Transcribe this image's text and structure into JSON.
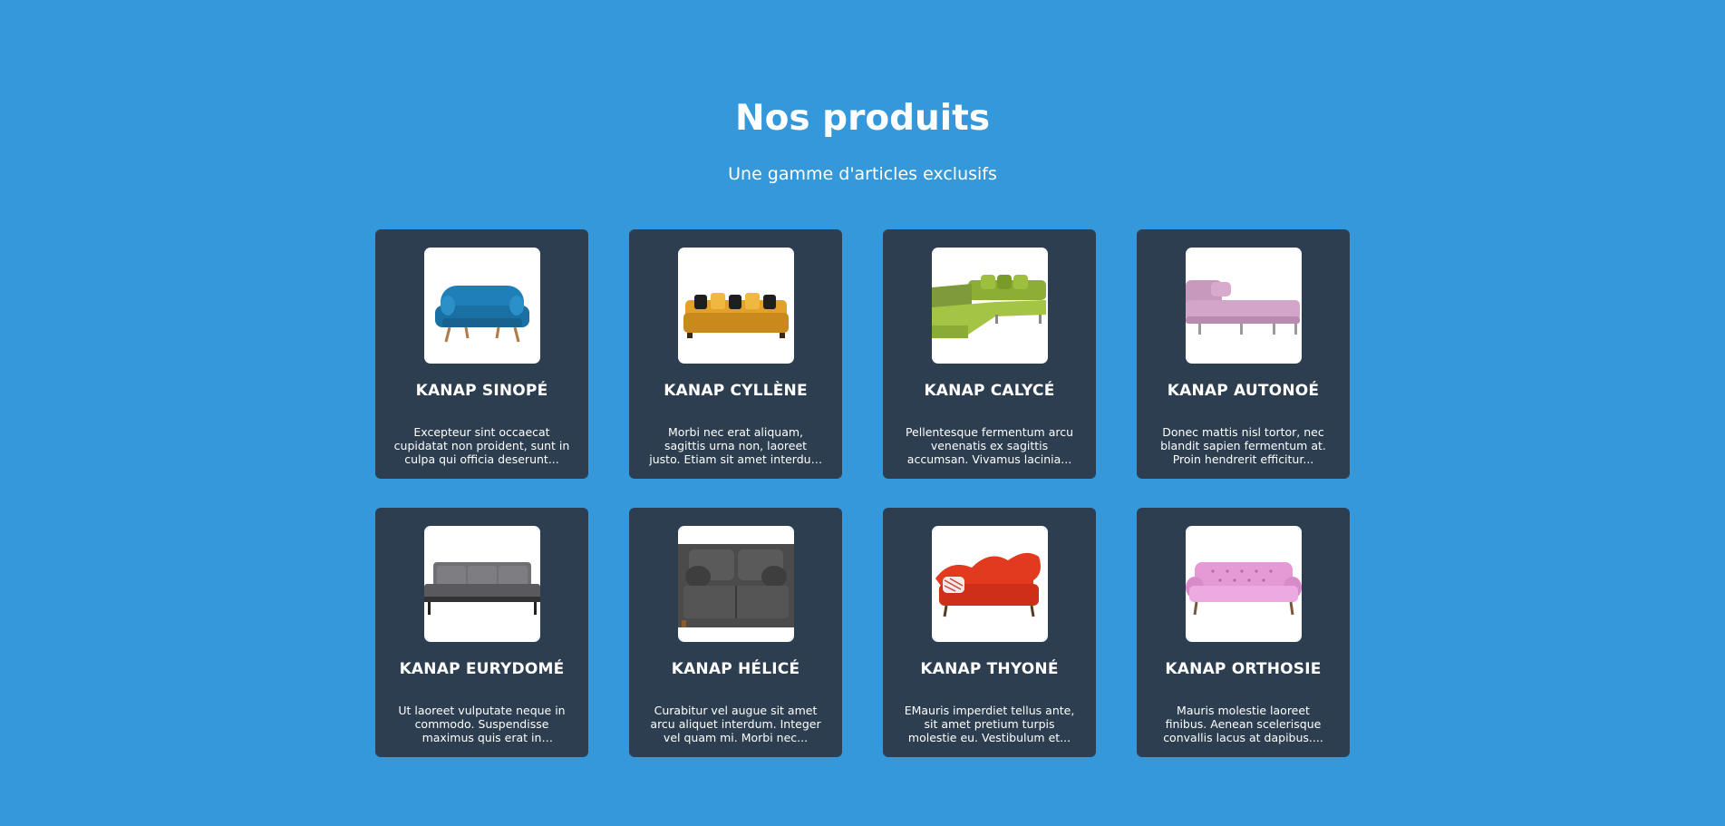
{
  "header": {
    "title": "Nos produits",
    "subtitle": "Une gamme d'articles exclusifs"
  },
  "colors": {
    "background": "#3498db",
    "card": "#2c3e50",
    "text": "#ffffff"
  },
  "products": [
    {
      "name": "KANAP SINOPÉ",
      "description": "Excepteur sint occaecat cupidatat non proident, sunt in culpa qui officia deserunt...",
      "image": "sofa-blue-icon",
      "color": "#1f7fb8"
    },
    {
      "name": "KANAP CYLLÈNE",
      "description": "Morbi nec erat aliquam, sagittis urna non, laoreet justo. Etiam sit amet interdum dia...",
      "image": "sofa-yellow-icon",
      "color": "#e3a12a"
    },
    {
      "name": "KANAP CALYCÉ",
      "description": "Pellentesque fermentum arcu venenatis ex sagittis accumsan. Vivamus lacinia...",
      "image": "sofa-green-icon",
      "color": "#8dae34"
    },
    {
      "name": "KANAP AUTONOÉ",
      "description": "Donec mattis nisl tortor, nec blandit sapien fermentum at. Proin hendrerit efficitur...",
      "image": "sofa-pink-icon",
      "color": "#d3a5c8"
    },
    {
      "name": "KANAP EURYDOMÉ",
      "description": "Ut laoreet vulputate neque in commodo. Suspendisse maximus quis erat in sagittis....",
      "image": "sofa-grey-icon",
      "color": "#707074"
    },
    {
      "name": "KANAP HÉLICÉ",
      "description": "Curabitur vel augue sit amet arcu aliquet interdum. Integer vel quam mi. Morbi nec...",
      "image": "sofa-dark-grey-icon",
      "color": "#4b4b4b"
    },
    {
      "name": "KANAP THYONÉ",
      "description": "EMauris imperdiet tellus ante, sit amet pretium turpis molestie eu. Vestibulum et...",
      "image": "sofa-red-icon",
      "color": "#e23a1f"
    },
    {
      "name": "KANAP ORTHOSIE",
      "description": "Mauris molestie laoreet finibus. Aenean scelerisque convallis lacus at dapibus....",
      "image": "sofa-pink-tufted-icon",
      "color": "#e59ad6"
    }
  ]
}
